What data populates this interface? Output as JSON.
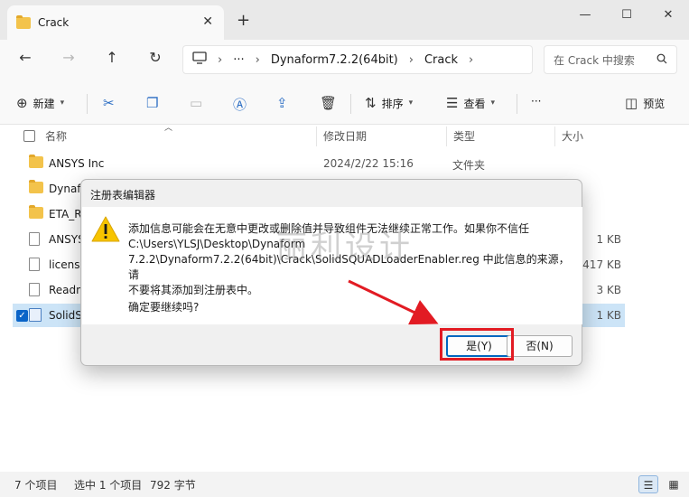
{
  "window": {
    "tab_title": "Crack",
    "tab_close": "✕",
    "new_tab": "+",
    "controls": {
      "minimize": "—",
      "maximize": "☐",
      "close": "✕"
    }
  },
  "nav": {
    "back": "←",
    "forward": "→",
    "up": "↑",
    "refresh": "↻",
    "breadcrumb_more": "···",
    "breadcrumbs": [
      "Dynaform7.2.2(64bit)",
      "Crack"
    ],
    "search_placeholder": "在 Crack 中搜索"
  },
  "toolbar": {
    "new_label": "新建",
    "sort_label": "排序",
    "view_label": "查看",
    "more": "···",
    "preview_label": "预览"
  },
  "columns": {
    "name": "名称",
    "modified": "修改日期",
    "type": "类型",
    "size": "大小"
  },
  "files": [
    {
      "name": "ANSYS Inc",
      "date": "2024/2/22 15:16",
      "type": "文件夹",
      "size": "",
      "kind": "folder"
    },
    {
      "name": "Dynaform",
      "date": "",
      "type": "",
      "size": "",
      "kind": "folder"
    },
    {
      "name": "ETA_R",
      "date": "",
      "type": "",
      "size": "",
      "kind": "folder"
    },
    {
      "name": "ANSYS",
      "date": "",
      "type": "",
      "size": "1 KB",
      "kind": "file"
    },
    {
      "name": "license",
      "date": "",
      "type": "",
      "size": "417 KB",
      "kind": "file"
    },
    {
      "name": "Readme",
      "date": "",
      "type": "",
      "size": "3 KB",
      "kind": "file"
    },
    {
      "name": "SolidS",
      "date": "",
      "type": "",
      "size": "1 KB",
      "kind": "reg"
    }
  ],
  "status": {
    "count": "7 个项目",
    "selected": "选中 1 个项目",
    "size": "792 字节"
  },
  "dialog": {
    "title": "注册表编辑器",
    "message_lines": [
      "添加信息可能会在无意中更改或删除值并导致组件无法继续正常工作。如果你不信任",
      "C:\\Users\\YLSJ\\Desktop\\Dynaform",
      "7.2.2\\Dynaform7.2.2(64bit)\\Crack\\SolidSQUADLoaderEnabler.reg 中此信息的来源，请",
      "不要将其添加到注册表中。"
    ],
    "question": "确定要继续吗?",
    "yes_label": "是(Y)",
    "no_label": "否(N)"
  },
  "watermark": "丽利设计",
  "colors": {
    "accent": "#0067c0",
    "highlight": "#e21b23",
    "selected_row": "#cce4f7"
  }
}
